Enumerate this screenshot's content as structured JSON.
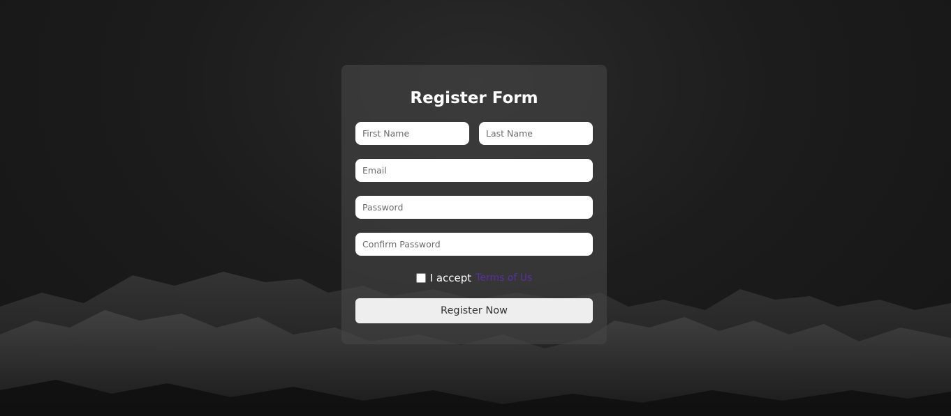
{
  "form": {
    "title": "Register Form",
    "first_name_placeholder": "First Name",
    "last_name_placeholder": "Last Name",
    "email_placeholder": "Email",
    "password_placeholder": "Password",
    "confirm_password_placeholder": "Confirm Password",
    "terms_prefix": "I accept",
    "terms_link": "Terms of Us",
    "submit_label": "Register Now",
    "terms_checked": false
  },
  "colors": {
    "link": "#5b2fa0",
    "button_bg": "#eeeeee"
  }
}
